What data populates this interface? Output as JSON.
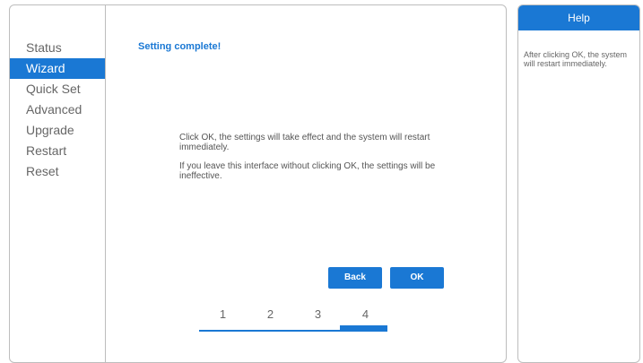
{
  "sidebar": {
    "items": [
      {
        "label": "Status",
        "active": false
      },
      {
        "label": "Wizard",
        "active": true
      },
      {
        "label": "Quick Set",
        "active": false
      },
      {
        "label": "Advanced",
        "active": false
      },
      {
        "label": "Upgrade",
        "active": false
      },
      {
        "label": "Restart",
        "active": false
      },
      {
        "label": "Reset",
        "active": false
      }
    ]
  },
  "main": {
    "title": "Setting complete!",
    "message_1": "Click OK, the settings will take effect and the system will restart immediately.",
    "message_2": "If you leave this interface without clicking OK, the settings will be ineffective.",
    "back_label": "Back",
    "ok_label": "OK",
    "steps": [
      "1",
      "2",
      "3",
      "4"
    ],
    "current_step": 4
  },
  "help": {
    "title": "Help",
    "text": "After clicking OK, the system will restart immediately."
  },
  "colors": {
    "accent": "#1a78d4",
    "text": "#666666",
    "border": "#bdbdbd"
  }
}
